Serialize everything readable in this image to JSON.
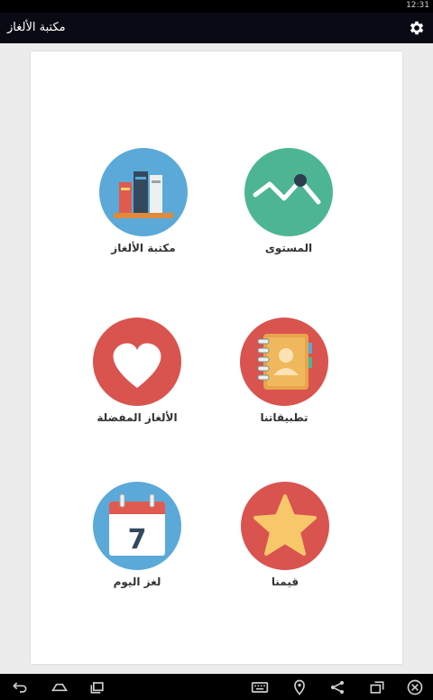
{
  "status_bar": {
    "time": "12:31"
  },
  "app_bar": {
    "title": "مكتبة الألغاز",
    "settings_icon": "gear-icon"
  },
  "tiles": [
    {
      "id": "level",
      "label": "المستوى",
      "icon": "chart-line-icon",
      "color": "#4db594"
    },
    {
      "id": "library",
      "label": "مكتبة الألغاز",
      "icon": "books-icon",
      "color": "#5aa9d8"
    },
    {
      "id": "apps",
      "label": "تطبيقاتنا",
      "icon": "address-book-icon",
      "color": "#d9534f"
    },
    {
      "id": "favorites",
      "label": "الألغاز المفضلة",
      "icon": "heart-icon",
      "color": "#d9534f"
    },
    {
      "id": "rate",
      "label": "قيمنا",
      "icon": "star-icon",
      "color": "#d9534f"
    },
    {
      "id": "daily",
      "label": "لغز اليوم",
      "icon": "calendar-icon",
      "color": "#5aa9d8",
      "calendar_day": "7"
    }
  ],
  "nav_bar": {
    "icons": [
      "back-icon",
      "home-icon",
      "recent-apps-icon",
      "keyboard-icon",
      "location-icon",
      "share-icon",
      "screen-rotate-icon",
      "close-icon"
    ]
  }
}
